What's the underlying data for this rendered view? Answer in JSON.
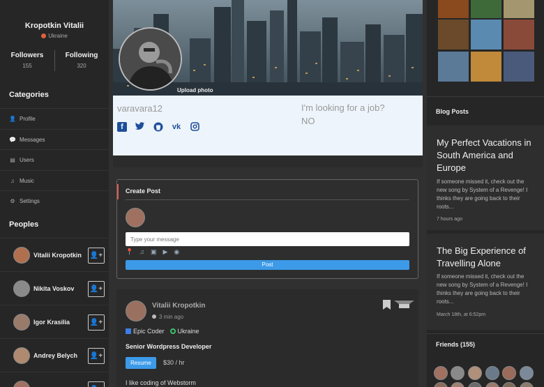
{
  "profile": {
    "name": "Kropotkin Vitalii",
    "location": "Ukraine",
    "followers_label": "Followers",
    "followers_count": "155",
    "following_label": "Following",
    "following_count": "320"
  },
  "categories": {
    "title": "Categories",
    "items": [
      {
        "label": "Profile",
        "icon": "user-icon"
      },
      {
        "label": "Messages",
        "icon": "comments-icon"
      },
      {
        "label": "Users",
        "icon": "list-icon"
      },
      {
        "label": "Music",
        "icon": "music-icon"
      },
      {
        "label": "Settings",
        "icon": "gear-icon"
      }
    ]
  },
  "peoples": {
    "title": "Peoples",
    "items": [
      {
        "name": "Vitalii Kropotkin",
        "avatar_color": "#b07050"
      },
      {
        "name": "Nikita Voskov",
        "avatar_color": "#8a8a8a"
      },
      {
        "name": "Igor Krasilia",
        "avatar_color": "#9a7a6a"
      },
      {
        "name": "Andrey Belych",
        "avatar_color": "#b08a70"
      },
      {
        "name": "",
        "avatar_color": "#a07060"
      }
    ]
  },
  "cover": {
    "upload_label": "Upload photo"
  },
  "info": {
    "username": "varavara12",
    "job_question": "I'm looking for a job?",
    "job_answer": "NO",
    "socials": [
      "facebook-icon",
      "twitter-icon",
      "github-icon",
      "vk-icon",
      "instagram-icon"
    ]
  },
  "create_post": {
    "title": "Create Post",
    "placeholder": "Type your message",
    "post_label": "Post"
  },
  "post": {
    "author": "Vitalii Kropotkin",
    "time": "3 min ago",
    "badge_1": "Epic Coder",
    "badge_2": "Ukraine",
    "role": "Senior Wordpress Developer",
    "resume_label": "Resume",
    "rate": "$30 / hr",
    "bio": "I like coding of Webstorm"
  },
  "blog": {
    "title": "Blog Posts",
    "posts": [
      {
        "heading": "My Perfect Vacations in South America and Europe",
        "excerpt": "If someone missed it, check out the new song by System of a Revenge! I thinks they are going back to their roots...",
        "date": "7 hours ago"
      },
      {
        "heading": "The Big Experience of Travelling Alone",
        "excerpt": "If someone missed it, check out the new song by System of a Revenge! I thinks they are going back to their roots...",
        "date": "March 18th, at 6:52pm"
      }
    ]
  },
  "friends": {
    "title": "Friends (155)"
  },
  "colors": {
    "accent": "#3c9ae8",
    "create_accent": "#e05a4b",
    "social": "#1f4e99"
  }
}
